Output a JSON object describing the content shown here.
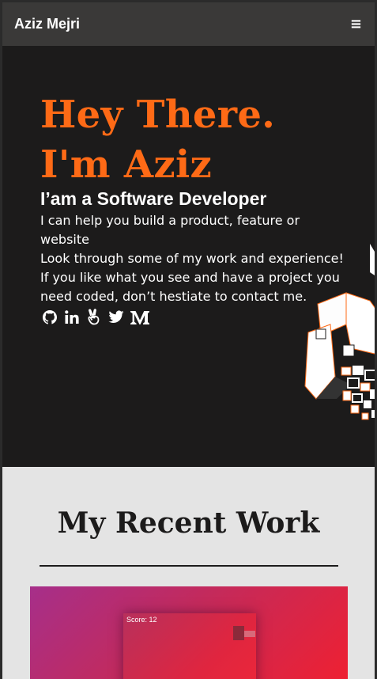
{
  "nav": {
    "brand": "Aziz Mejri",
    "menu_icon": "hamburger-icon",
    "menu_glyph": "≡"
  },
  "hero": {
    "greeting_line1": "Hey There.",
    "greeting_line2": "I'm Aziz",
    "subtitle": "I’am a Software Developer",
    "intro": [
      "I can help you build a product, feature or website",
      "Look through some of my work and experience!",
      "If you like what you see and have a project you need coded, don’t hestiate to contact me."
    ],
    "social_icons": [
      "github-icon",
      "linkedin-icon",
      "angellist-icon",
      "twitter-icon",
      "medium-icon"
    ]
  },
  "work": {
    "title": "My Recent Work",
    "project_preview": {
      "score_text": "Score: 12"
    }
  },
  "colors": {
    "accent": "#fe6a16",
    "hero_bg": "#1c1b1b",
    "nav_bg": "#3a3938",
    "work_bg": "#e4e4e4"
  }
}
